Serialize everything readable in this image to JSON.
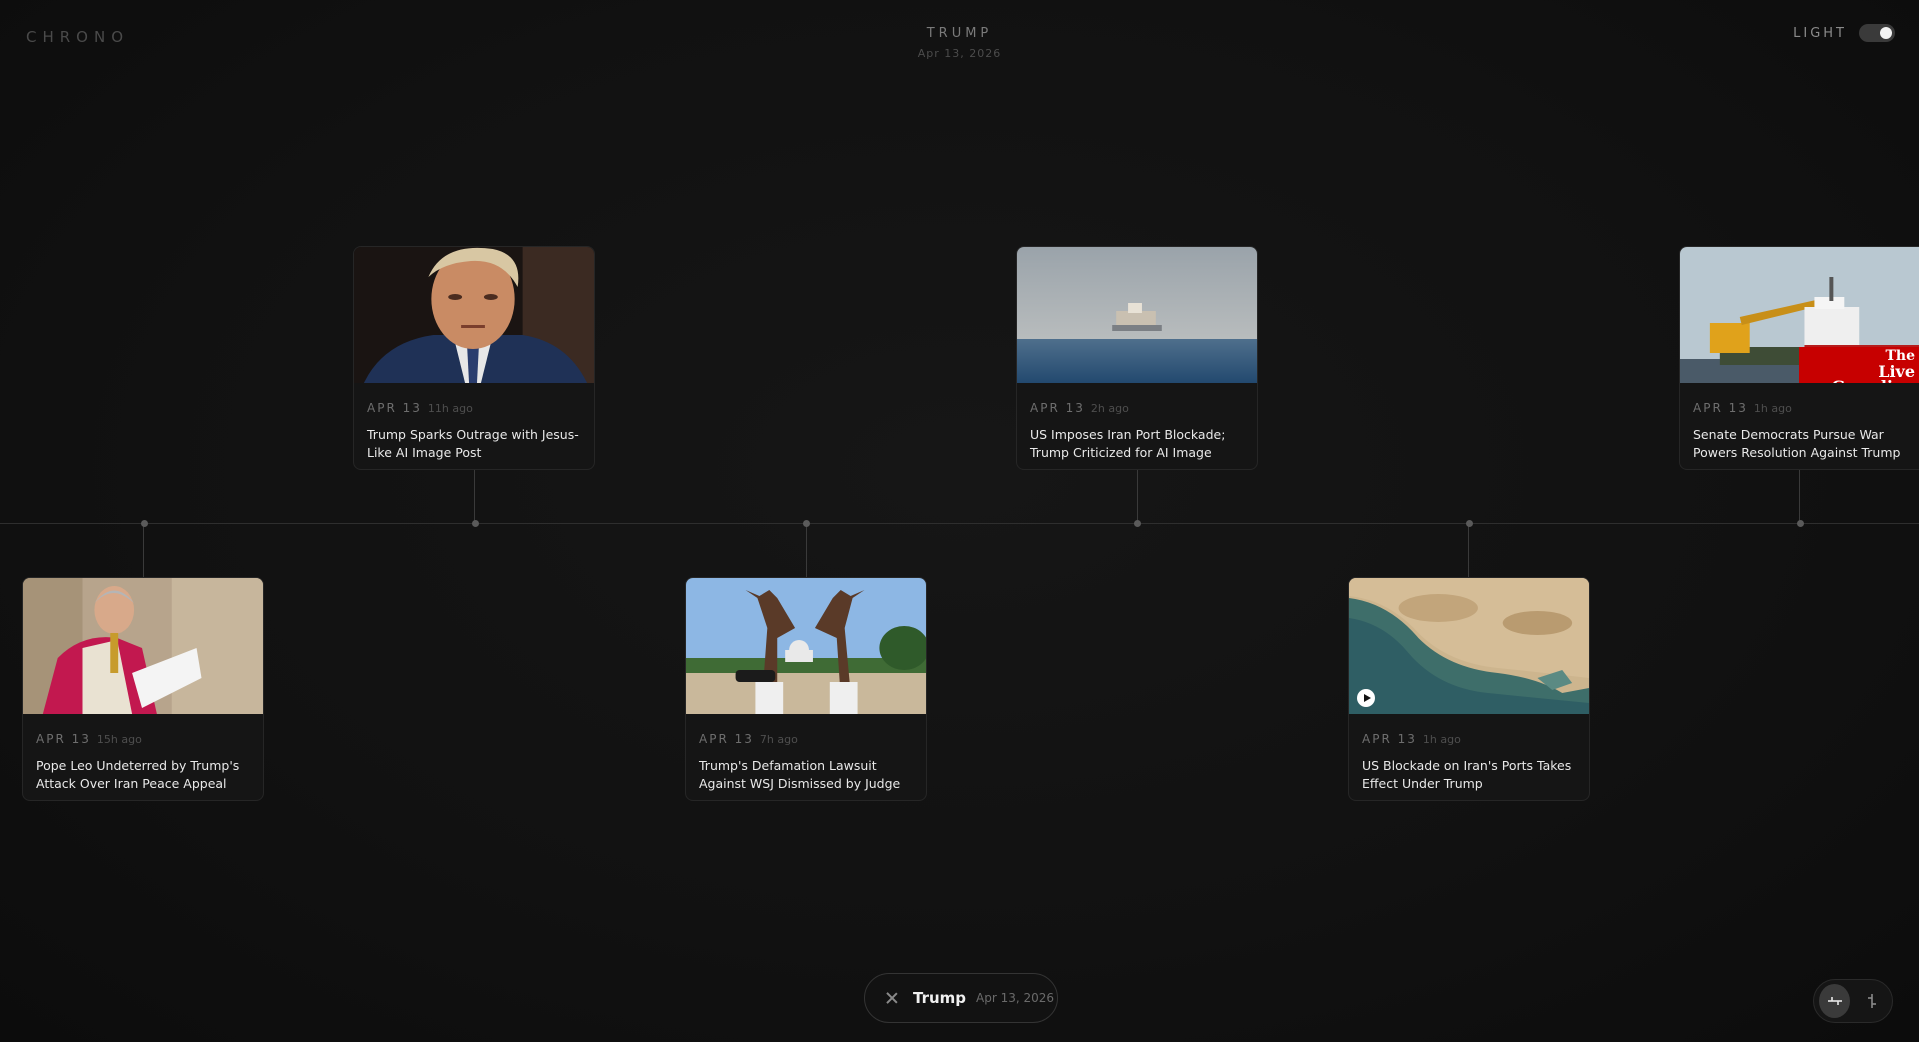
{
  "app": {
    "brand": "CHRONO"
  },
  "header": {
    "title": "TRUMP",
    "date": "Apr 13, 2026"
  },
  "theme_toggle": {
    "label": "LIGHT"
  },
  "cards": [
    {
      "date": "APR 13",
      "ago": "15h ago",
      "title": "Pope Leo Undeterred by Trump's Attack Over Iran Peace Appeal"
    },
    {
      "date": "APR 13",
      "ago": "11h ago",
      "title": "Trump Sparks Outrage with Jesus-Like AI Image Post"
    },
    {
      "date": "APR 13",
      "ago": "7h ago",
      "title": "Trump's Defamation Lawsuit Against WSJ Dismissed by Judge"
    },
    {
      "date": "APR 13",
      "ago": "2h ago",
      "title": "US Imposes Iran Port Blockade; Trump Criticized for AI Image"
    },
    {
      "date": "APR 13",
      "ago": "1h ago",
      "title": "US Blockade on Iran's Ports Takes Effect Under Trump"
    },
    {
      "date": "APR 13",
      "ago": "1h ago",
      "title": "Senate Democrats Pursue War Powers Resolution Against Trump",
      "badge_line1": "The",
      "badge_line2": "Live Guardian"
    }
  ],
  "query": {
    "term": "Trump",
    "date": "Apr 13, 2026"
  },
  "icons": {
    "close": "close-icon",
    "play": "play-icon",
    "horizontal_layout": "horizontal-layout-icon",
    "vertical_layout": "vertical-layout-icon"
  }
}
